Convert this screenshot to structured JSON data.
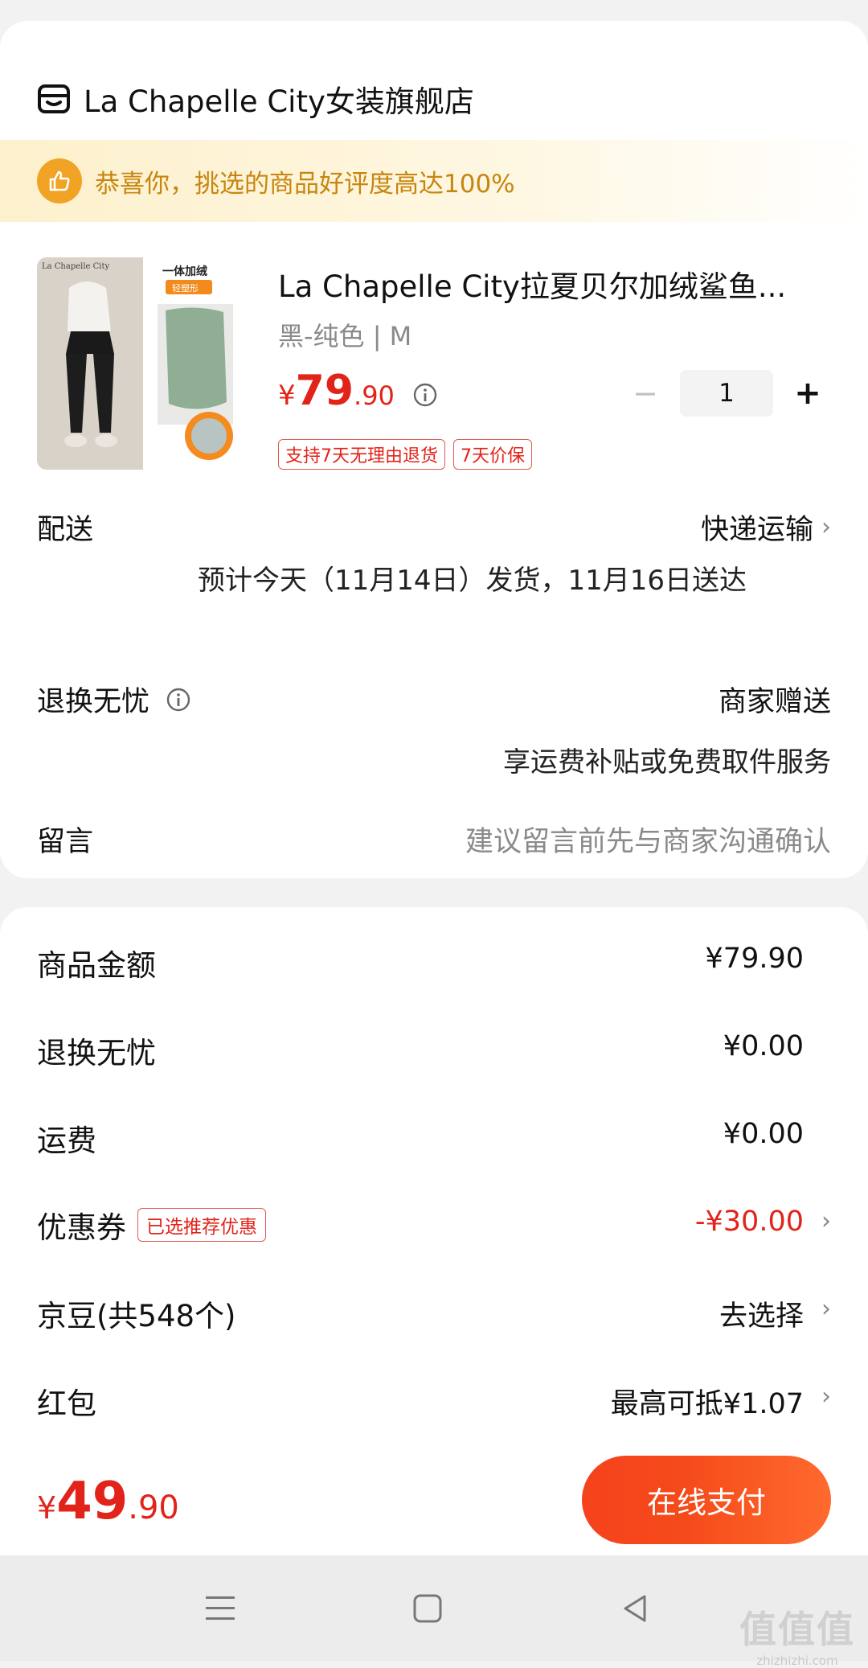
{
  "store": {
    "name": "La Chapelle City女装旗舰店",
    "icon": "store-icon"
  },
  "banner": {
    "text": "恭喜你，挑选的商品好评度高达100%",
    "icon": "thumbs-up-icon"
  },
  "product": {
    "title": "La Chapelle City拉夏贝尔加绒鲨鱼...",
    "spec": "黑-纯色 | M",
    "price_symbol": "¥",
    "price_int": "79",
    "price_dec": ".90",
    "quantity": "1",
    "minus_label": "−",
    "plus_label": "+",
    "tags": [
      "支持7天无理由退货",
      "7天价保"
    ],
    "image_text": {
      "brand": "La Chapelle City",
      "badge_top": "一体加绒",
      "badge_sub": "轻塑形"
    }
  },
  "delivery": {
    "label": "配送",
    "method": "快递运输",
    "estimate": "预计今天（11月14日）发货，11月16日送达"
  },
  "returns": {
    "label": "退换无忧",
    "value": "商家赠送",
    "desc": "享运费补贴或免费取件服务"
  },
  "message": {
    "label": "留言",
    "placeholder": "建议留言前先与商家沟通确认"
  },
  "fees": [
    {
      "label": "商品金额",
      "value": "¥79.90"
    },
    {
      "label": "退换无忧",
      "value": "¥0.00"
    },
    {
      "label": "运费",
      "value": "¥0.00"
    },
    {
      "label": "优惠券",
      "tag": "已选推荐优惠",
      "value": "-¥30.00"
    },
    {
      "label": "京豆(共548个)",
      "value": "去选择"
    },
    {
      "label": "红包",
      "value": "最高可抵¥1.07"
    }
  ],
  "footer": {
    "total_symbol": "¥",
    "total_int": "49",
    "total_dec": ".90",
    "pay_label": "在线支付"
  },
  "watermark": {
    "big": "值值值",
    "small": "zhizhizhi.com"
  },
  "colors": {
    "accent_red": "#e2231a",
    "banner_gold": "#c7860f",
    "pay_gradient": "#f5421d"
  }
}
